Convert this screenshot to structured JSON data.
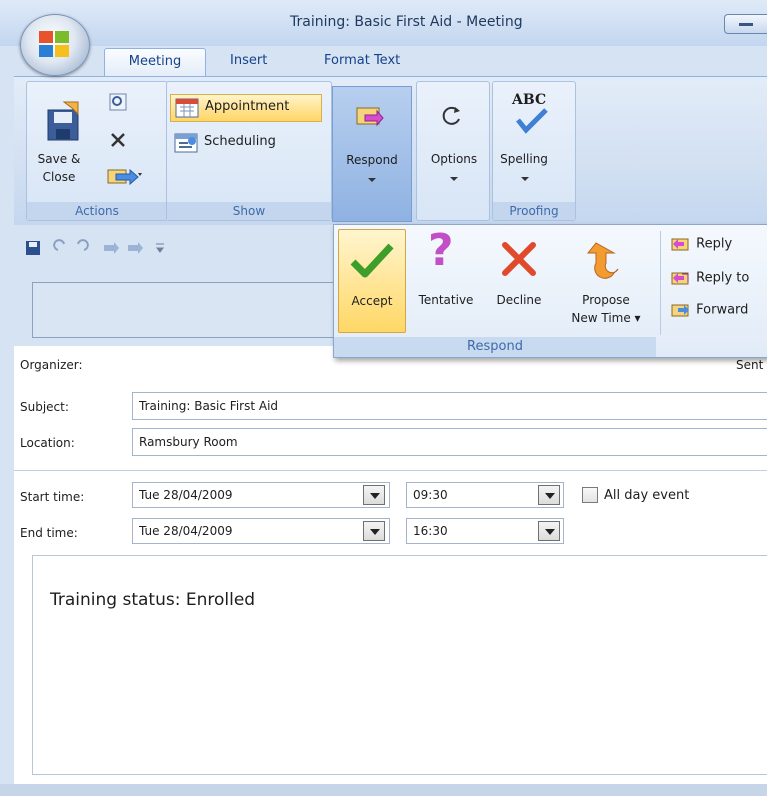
{
  "window": {
    "title": "Training: Basic First Aid - Meeting"
  },
  "tabs": [
    "Meeting",
    "Insert",
    "Format Text"
  ],
  "ribbon": {
    "actions": {
      "save_close_line1": "Save &",
      "save_close_line2": "Close",
      "group": "Actions"
    },
    "show": {
      "appointment": "Appointment",
      "scheduling": "Scheduling",
      "group": "Show"
    },
    "respond": {
      "label": "Respond"
    },
    "options": {
      "label": "Options"
    },
    "proofing": {
      "spelling": "Spelling",
      "group": "Proofing",
      "abc": "ABC"
    }
  },
  "respond_menu": {
    "accept": "Accept",
    "tentative": "Tentative",
    "decline": "Decline",
    "propose_line1": "Propose",
    "propose_line2": "New Time",
    "reply": "Reply",
    "reply_to": "Reply to",
    "forward": "Forward",
    "group": "Respond"
  },
  "form": {
    "organizer_label": "Organizer:",
    "sent_label": "Sent",
    "subject_label": "Subject:",
    "subject_value": "Training: Basic First Aid",
    "location_label": "Location:",
    "location_value": "Ramsbury Room",
    "start_label": "Start time:",
    "start_date": "Tue 28/04/2009",
    "start_time": "09:30",
    "all_day": "All day event",
    "end_label": "End time:",
    "end_date": "Tue 28/04/2009",
    "end_time": "16:30"
  },
  "body": {
    "text": "Training status: Enrolled"
  },
  "colors": {
    "accent": "#15428b",
    "accept_highlight": "#ffd765",
    "respond_pressed": "#8fb2e2"
  },
  "icons": [
    "office-orb-icon",
    "save-icon",
    "close-x-icon",
    "forward-icon",
    "appointment-icon",
    "scheduling-icon",
    "respond-icon",
    "options-icon",
    "spelling-icon",
    "accept-check-icon",
    "tentative-question-icon",
    "decline-x-icon",
    "propose-arrow-icon",
    "reply-icon",
    "reply-all-icon",
    "forward-arrow-icon",
    "undo-icon",
    "redo-icon"
  ]
}
